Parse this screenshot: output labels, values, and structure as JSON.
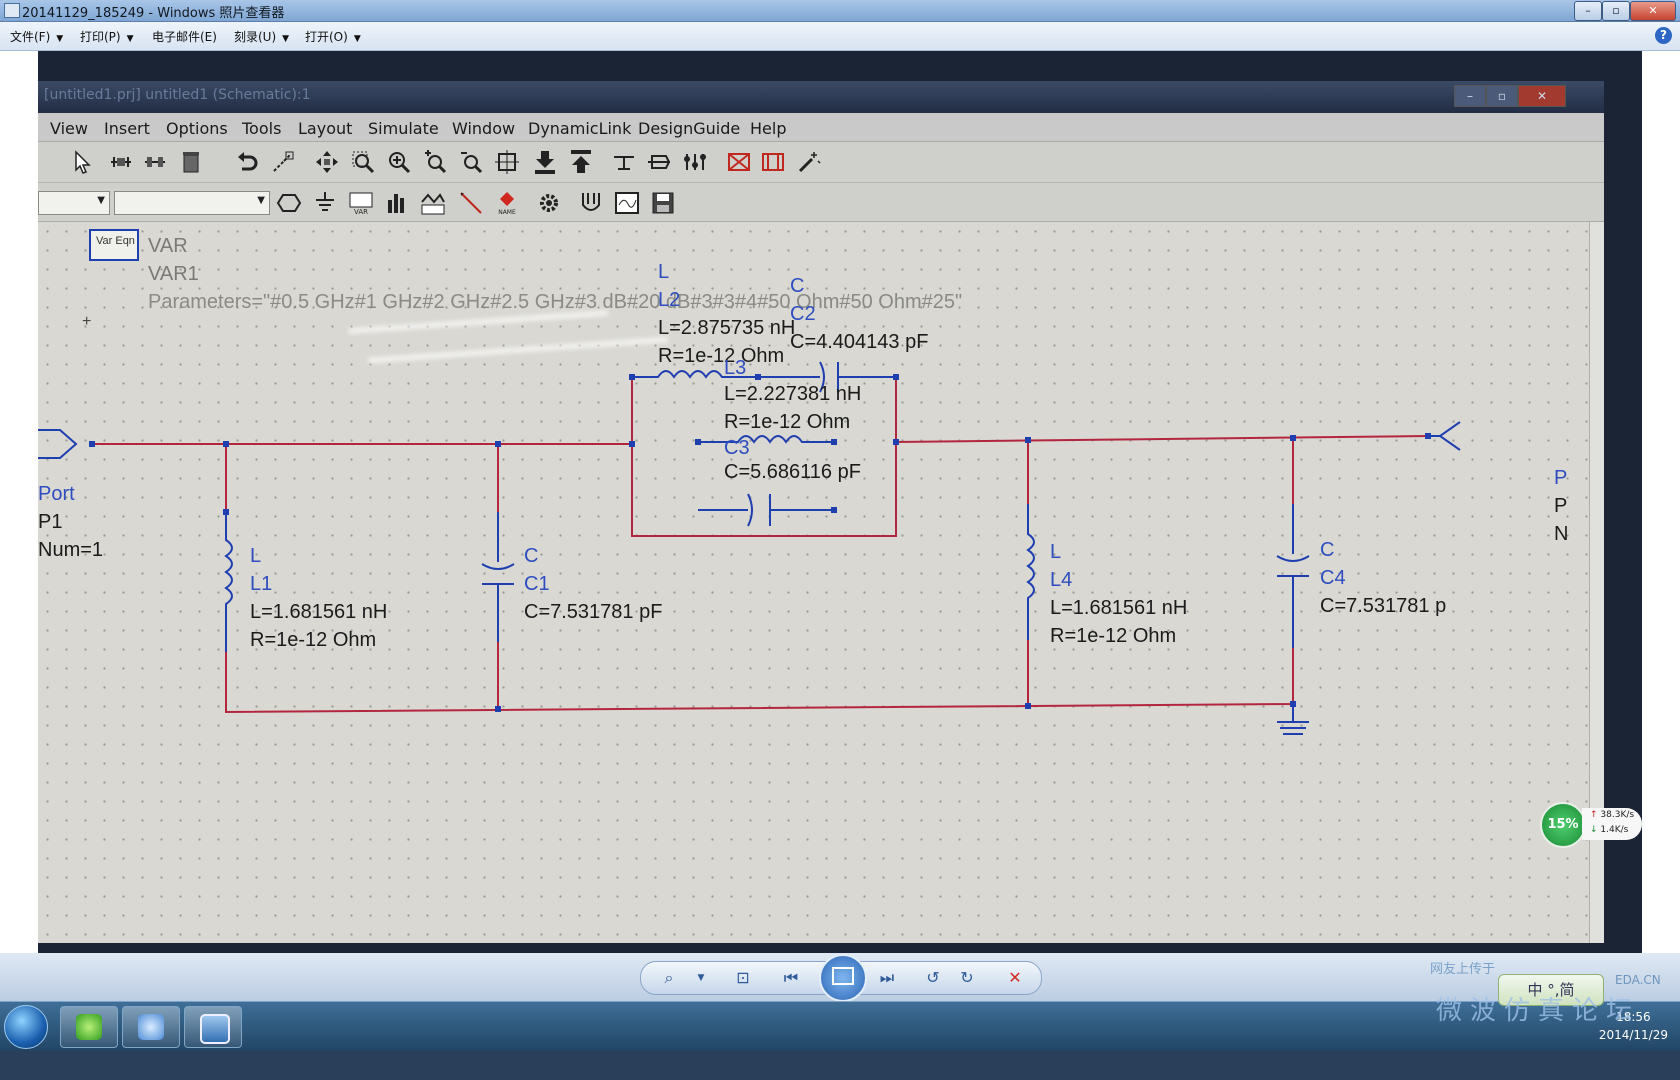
{
  "window": {
    "title": "20141129_185249 - Windows 照片查看器",
    "min": "–",
    "max": "▫",
    "close": "✕"
  },
  "viewer_menu": {
    "items": [
      {
        "label": "文件(F)"
      },
      {
        "label": "打印(P)"
      },
      {
        "label": "电子邮件(E)"
      },
      {
        "label": "刻录(U)"
      },
      {
        "label": "打开(O)"
      }
    ],
    "help": "?"
  },
  "ads": {
    "title": "[untitled1.prj] untitled1 (Schematic):1",
    "menu": [
      "View",
      "Insert",
      "Options",
      "Tools",
      "Layout",
      "Simulate",
      "Window",
      "DynamicLink",
      "DesignGuide",
      "Help"
    ]
  },
  "schematic": {
    "var": {
      "icon_text": "Var Eqn",
      "type": "VAR",
      "name": "VAR1",
      "params": "Parameters=\"#0.5 GHz#1 GHz#2 GHz#2.5 GHz#3 dB#20 dB#3#3#4#50 Ohm#50 Ohm#25\""
    },
    "port1": {
      "type": "Port",
      "name": "P1",
      "num": "Num=1"
    },
    "port2": {
      "type": "P",
      "name": "P",
      "num": "N"
    },
    "L1": {
      "type": "L",
      "name": "L1",
      "value": "L=1.681561 nH",
      "r": "R=1e-12 Ohm"
    },
    "C1": {
      "type": "C",
      "name": "C1",
      "value": "C=7.531781 pF"
    },
    "L2": {
      "type": "L",
      "name": "L2",
      "value": "L=2.875735 nH",
      "r": "R=1e-12 Ohm"
    },
    "C2": {
      "type": "C",
      "name": "C2",
      "value": "C=4.404143 pF"
    },
    "L3": {
      "type": "L",
      "name": "L3",
      "value": "L=2.227381 nH",
      "r": "R=1e-12 Ohm"
    },
    "C3": {
      "type": "C",
      "name": "C3",
      "value": "C=5.686116 pF"
    },
    "L4": {
      "type": "L",
      "name": "L4",
      "value": "L=1.681561 nH",
      "r": "R=1e-12 Ohm"
    },
    "C4": {
      "type": "C",
      "name": "C4",
      "value": "C=7.531781 p"
    }
  },
  "net_widget": {
    "percent": "15%",
    "up": "38.3K/s",
    "down": "1.4K/s"
  },
  "tray": {
    "time": "18:56",
    "date": "2014/11/29",
    "ime": "中 °,简",
    "watermark": "微波仿真论坛",
    "watermark_top": "网友上传于",
    "watermark_url": "EDA.CN"
  },
  "colors": {
    "wire": "#b3263d",
    "component": "#1f3fb0",
    "label": "#2e4dbf",
    "value_text": "#1b1b1b"
  }
}
